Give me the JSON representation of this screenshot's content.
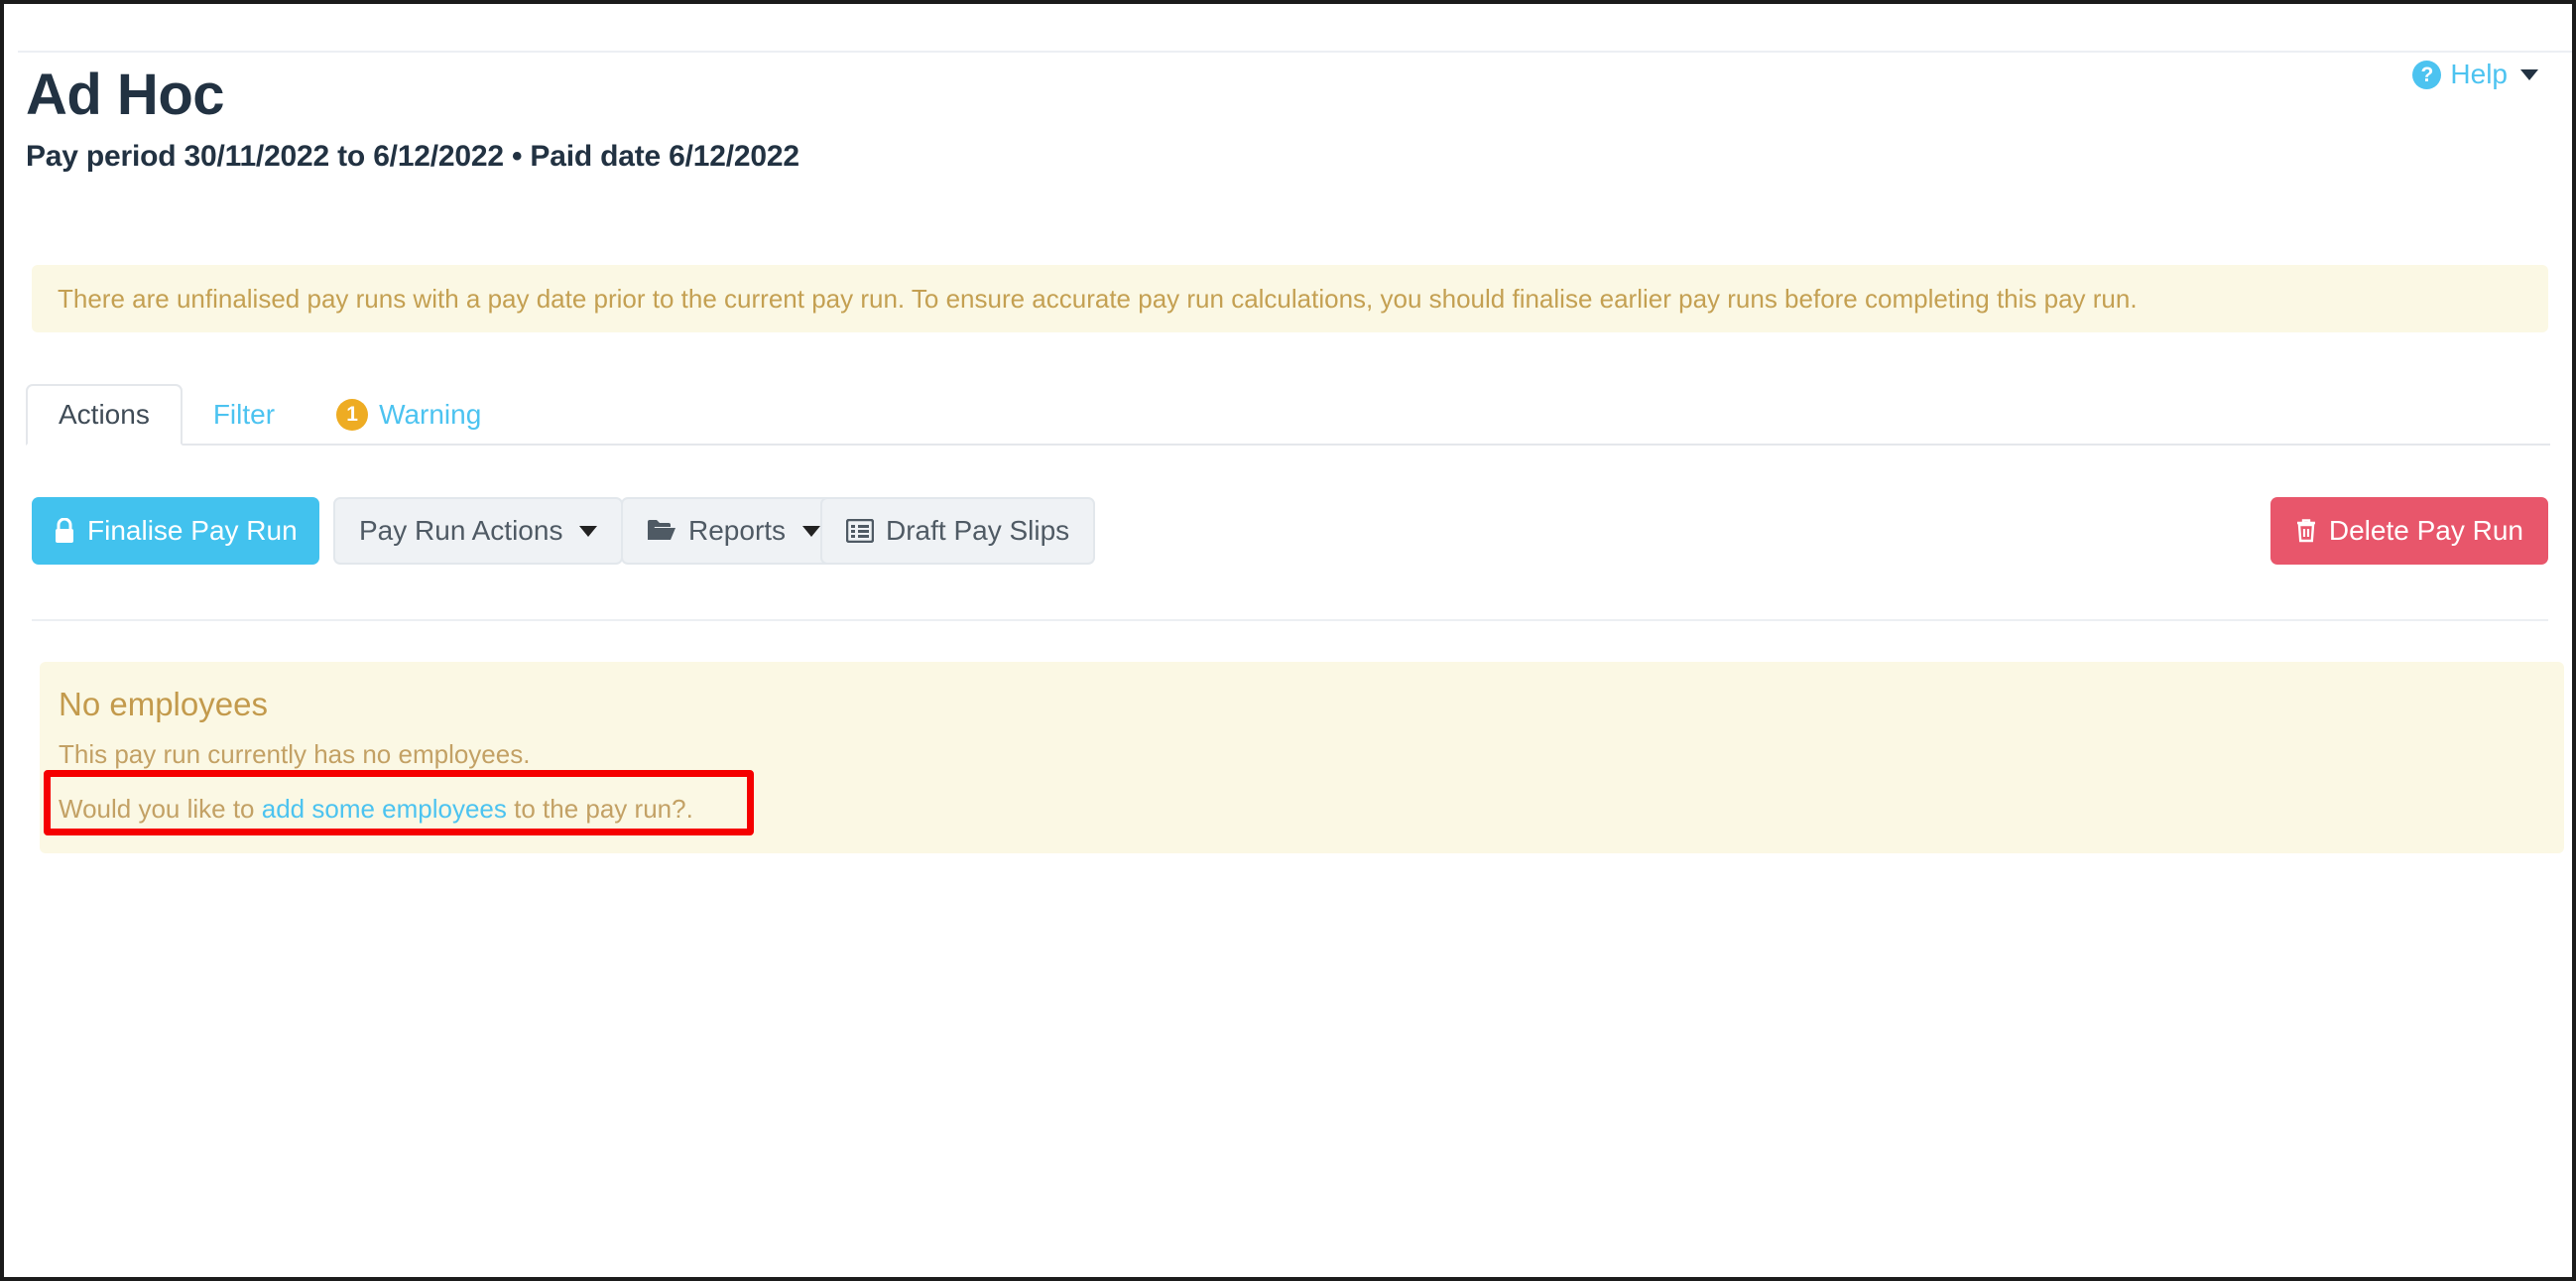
{
  "header": {
    "title": "Ad Hoc",
    "subtitle": "Pay period 30/11/2022 to 6/12/2022 • Paid date 6/12/2022"
  },
  "help": {
    "label": "Help",
    "icon": "question-circle-icon",
    "caret": "chevron-down-icon"
  },
  "alert": {
    "message": "There are unfinalised pay runs with a pay date prior to the current pay run. To ensure accurate pay run calculations, you should finalise earlier pay runs before completing this pay run."
  },
  "tabs": [
    {
      "label": "Actions",
      "active": true,
      "badge": null
    },
    {
      "label": "Filter",
      "active": false,
      "badge": null
    },
    {
      "label": "Warning",
      "active": false,
      "badge": "1"
    }
  ],
  "toolbar": {
    "finalise_label": "Finalise Pay Run",
    "finalise_icon": "lock-icon",
    "pay_run_actions_label": "Pay Run Actions",
    "reports_label": "Reports",
    "reports_icon": "folder-open-icon",
    "draft_pay_slips_label": "Draft Pay Slips",
    "draft_pay_slips_icon": "list-alt-icon",
    "delete_label": "Delete Pay Run",
    "delete_icon": "trash-icon"
  },
  "empty_state": {
    "title": "No employees",
    "subtitle": "This pay run currently has no employees.",
    "cta_prefix": "Would you like to ",
    "cta_link": "add some employees",
    "cta_suffix": " to the pay run?."
  },
  "colors": {
    "accent_blue": "#4cc3f0",
    "primary_button": "#42c2ee",
    "danger": "#e8566b",
    "warning_badge": "#eeac23",
    "alert_bg": "#fbf8e4",
    "alert_text": "#c4a052",
    "annotation": "#f50000",
    "title_text": "#223242"
  }
}
